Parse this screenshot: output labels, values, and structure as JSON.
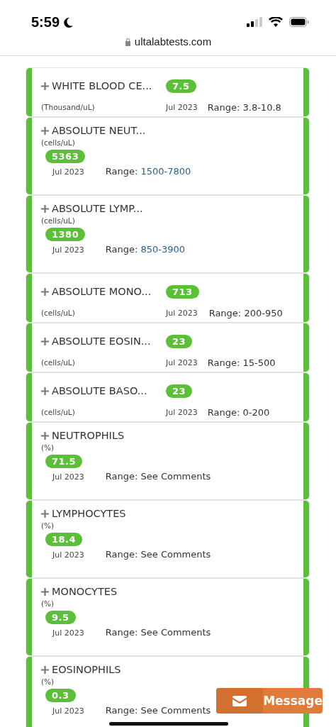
{
  "status_bar": {
    "time": "5:59",
    "url": "ultalabtests.com"
  },
  "results": [
    {
      "kind": "compact",
      "name": "WHITE BLOOD CE...",
      "units": "(Thousand/uL)",
      "value": "7.5",
      "date": "Jul 2023",
      "range_label": "Range:",
      "range": "3.8-10.8",
      "range_linked": false
    },
    {
      "kind": "stacked",
      "name": "ABSOLUTE NEUT...",
      "units": "(cells/uL)",
      "value": "5363",
      "date": "Jul 2023",
      "range_label": "Range:",
      "range": "1500-7800",
      "range_linked": true
    },
    {
      "kind": "stacked",
      "name": "ABSOLUTE LYMP...",
      "units": "(cells/uL)",
      "value": "1380",
      "date": "Jul 2023",
      "range_label": "Range:",
      "range": "850-3900",
      "range_linked": true
    },
    {
      "kind": "compact",
      "name": "ABSOLUTE MONO...",
      "units": "(cells/uL)",
      "value": "713",
      "date": "Jul 2023",
      "range_label": "Range:",
      "range": "200-950",
      "range_linked": false
    },
    {
      "kind": "compact",
      "name": "ABSOLUTE EOSIN...",
      "units": "(cells/uL)",
      "value": "23",
      "date": "Jul 2023",
      "range_label": "Range:",
      "range": "15-500",
      "range_linked": false
    },
    {
      "kind": "compact",
      "name": "ABSOLUTE BASO...",
      "units": "(cells/uL)",
      "value": "23",
      "date": "Jul 2023",
      "range_label": "Range:",
      "range": "0-200",
      "range_linked": false
    },
    {
      "kind": "stacked",
      "name": "NEUTROPHILS",
      "units": "(%)",
      "value": "71.5",
      "date": "Jul 2023",
      "range_label": "Range:",
      "range": "See Comments",
      "range_linked": false
    },
    {
      "kind": "stacked",
      "name": "LYMPHOCYTES",
      "units": "(%)",
      "value": "18.4",
      "date": "Jul 2023",
      "range_label": "Range:",
      "range": "See Comments",
      "range_linked": false
    },
    {
      "kind": "stacked",
      "name": "MONOCYTES",
      "units": "(%)",
      "value": "9.5",
      "date": "Jul 2023",
      "range_label": "Range:",
      "range": "See Comments",
      "range_linked": false
    },
    {
      "kind": "stacked",
      "name": "EOSINOPHILS",
      "units": "(%)",
      "value": "0.3",
      "date": "Jul 2023",
      "range_label": "Range:",
      "range": "See Comments",
      "range_linked": false
    }
  ],
  "message_button": {
    "label": "Message"
  }
}
